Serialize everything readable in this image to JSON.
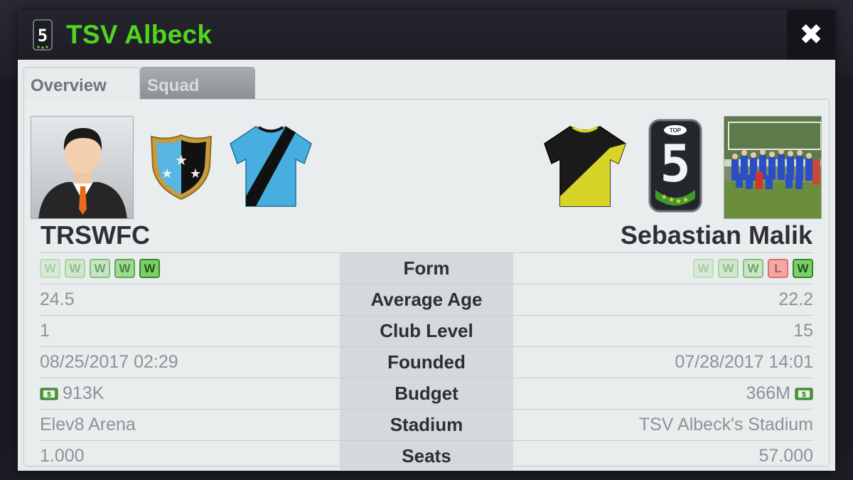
{
  "header": {
    "title": "TSV Albeck",
    "close_label": "✖"
  },
  "tabs": [
    {
      "label": "Overview",
      "active": true
    },
    {
      "label": "Squad",
      "active": false
    }
  ],
  "left_team": {
    "name": "TRSWFC"
  },
  "right_team": {
    "name": "Sebastian Malik"
  },
  "form": {
    "label": "Form",
    "left": [
      "W",
      "W",
      "W",
      "W",
      "W"
    ],
    "right": [
      "W",
      "W",
      "W",
      "L",
      "W"
    ]
  },
  "stats": [
    {
      "label": "Average Age",
      "left": "24.5",
      "right": "22.2"
    },
    {
      "label": "Club Level",
      "left": "1",
      "right": "15"
    },
    {
      "label": "Founded",
      "left": "08/25/2017 02:29",
      "right": "07/28/2017 14:01"
    },
    {
      "label": "Budget",
      "left": "913K",
      "right": "366M"
    },
    {
      "label": "Stadium",
      "left": "Elev8 Arena",
      "right": "TSV Albeck's Stadium"
    },
    {
      "label": "Seats",
      "left": "1.000",
      "right": "57.000"
    }
  ],
  "colors": {
    "title_green": "#4fd61d",
    "win_green": "#3fa83a",
    "loss_red": "#d9534f"
  },
  "icons": {
    "level_badge_digit": "5",
    "level_badge_logo": "TOP"
  }
}
